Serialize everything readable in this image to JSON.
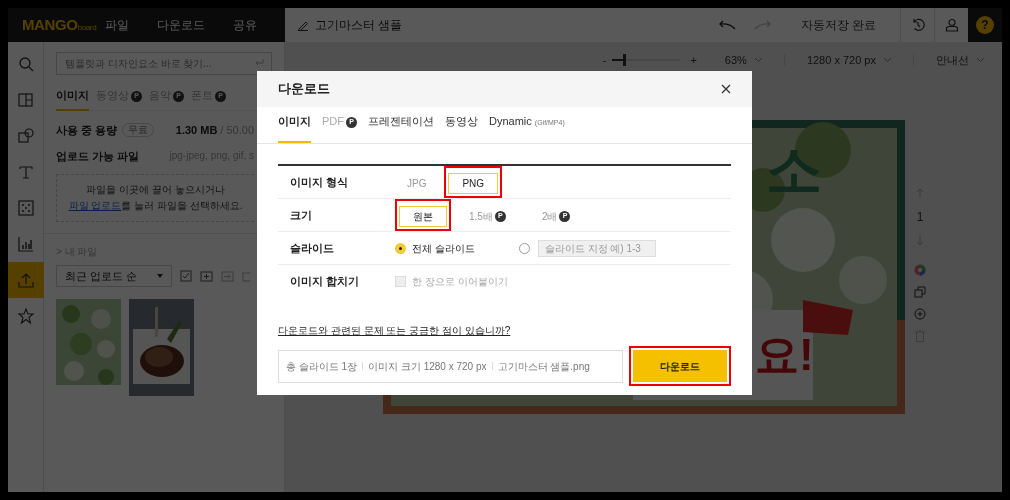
{
  "app_bar": {
    "logo": "MANGO",
    "logo_suffix": "board",
    "menus": [
      "파일",
      "다운로드",
      "공유"
    ],
    "document_title": "고기마스터 샘플",
    "save_status": "자동저장 완료",
    "help_label": "?"
  },
  "tool_rail": [
    {
      "kind": "search",
      "selected": false
    },
    {
      "kind": "layout",
      "selected": false
    },
    {
      "kind": "elements",
      "selected": false
    },
    {
      "kind": "text",
      "selected": false
    },
    {
      "kind": "pattern",
      "selected": false
    },
    {
      "kind": "chart",
      "selected": false
    },
    {
      "kind": "upload",
      "selected": true
    },
    {
      "kind": "star",
      "selected": false
    }
  ],
  "side_panel": {
    "search": {
      "placeholder": "템플릿과 디자인요소 바로 찾기..."
    },
    "tabs": [
      {
        "label": "이미지",
        "selected": true
      },
      {
        "label": "동영상",
        "selected": false,
        "badge": "P"
      },
      {
        "label": "음악",
        "selected": false,
        "badge": "P"
      },
      {
        "label": "폰트",
        "selected": false,
        "badge": "P"
      }
    ],
    "usage_label": "사용 중 용량",
    "usage_badge": "무료",
    "usage_value": "1.30 MB",
    "usage_limit": "/ 50.00",
    "formats_label": "업로드 가능 파일",
    "formats_value": "jpg-jpeg, png, gif, s",
    "drop_text": "파일을 이곳에 끌어 놓으시거나",
    "drop_link": "파일 업로드",
    "drop_text_end": "를 눌러 파일을 선택하세요.",
    "my_files": "> 내 파일",
    "sort": "최근 업로드 순"
  },
  "toolbar": {
    "zoom_minus": "-",
    "zoom_plus": "+",
    "zoom_slider": {
      "level": 0.15
    },
    "zoom": "63%",
    "canvas_size": "1280 x 720 px",
    "guides": "안내선"
  },
  "page_nav": {
    "page": "1"
  },
  "slide": {
    "texts": [
      "소",
      "요!"
    ]
  },
  "dialog": {
    "title": "다운로드",
    "tabs": [
      {
        "label": "이미지",
        "selected": true
      },
      {
        "label": "PDF",
        "selected": false,
        "badge": "P",
        "disabled": true
      },
      {
        "label": "프레젠테이션",
        "selected": false
      },
      {
        "label": "동영상",
        "selected": false
      },
      {
        "label": "Dynamic",
        "suffix": "(Gif/MP4)",
        "selected": false
      }
    ],
    "format": {
      "label": "이미지 형식",
      "options": [
        {
          "label": "JPG",
          "selected": false,
          "highlighted": false
        },
        {
          "label": "PNG",
          "selected": true,
          "highlighted": true
        }
      ]
    },
    "size": {
      "label": "크기",
      "options": [
        {
          "label": "원본",
          "selected": true,
          "highlighted": true
        },
        {
          "label": "1.5배",
          "selected": false,
          "highlighted": false,
          "badge": "P"
        },
        {
          "label": "2배",
          "selected": false,
          "highlighted": false,
          "badge": "P"
        }
      ]
    },
    "slides": {
      "label": "슬라이드",
      "options": [
        {
          "label": "전체 슬라이드",
          "selected": true
        },
        {
          "placeholder": "슬라이드 지정 예) 1-3",
          "selected": false
        }
      ]
    },
    "merge": {
      "label": "이미지 합치기",
      "option": "한 장으로 이어붙이기",
      "checked": false,
      "disabled": true
    },
    "help_link": "다운로드와 관련된 문제 또는 궁금한 점이 있습니까?",
    "summary": [
      "총 슬라이드 1장",
      "이미지 크기 1280 x 720 px",
      "고기마스터 샘플.png"
    ],
    "download_button": {
      "label": "다운로드",
      "highlighted": true
    }
  }
}
